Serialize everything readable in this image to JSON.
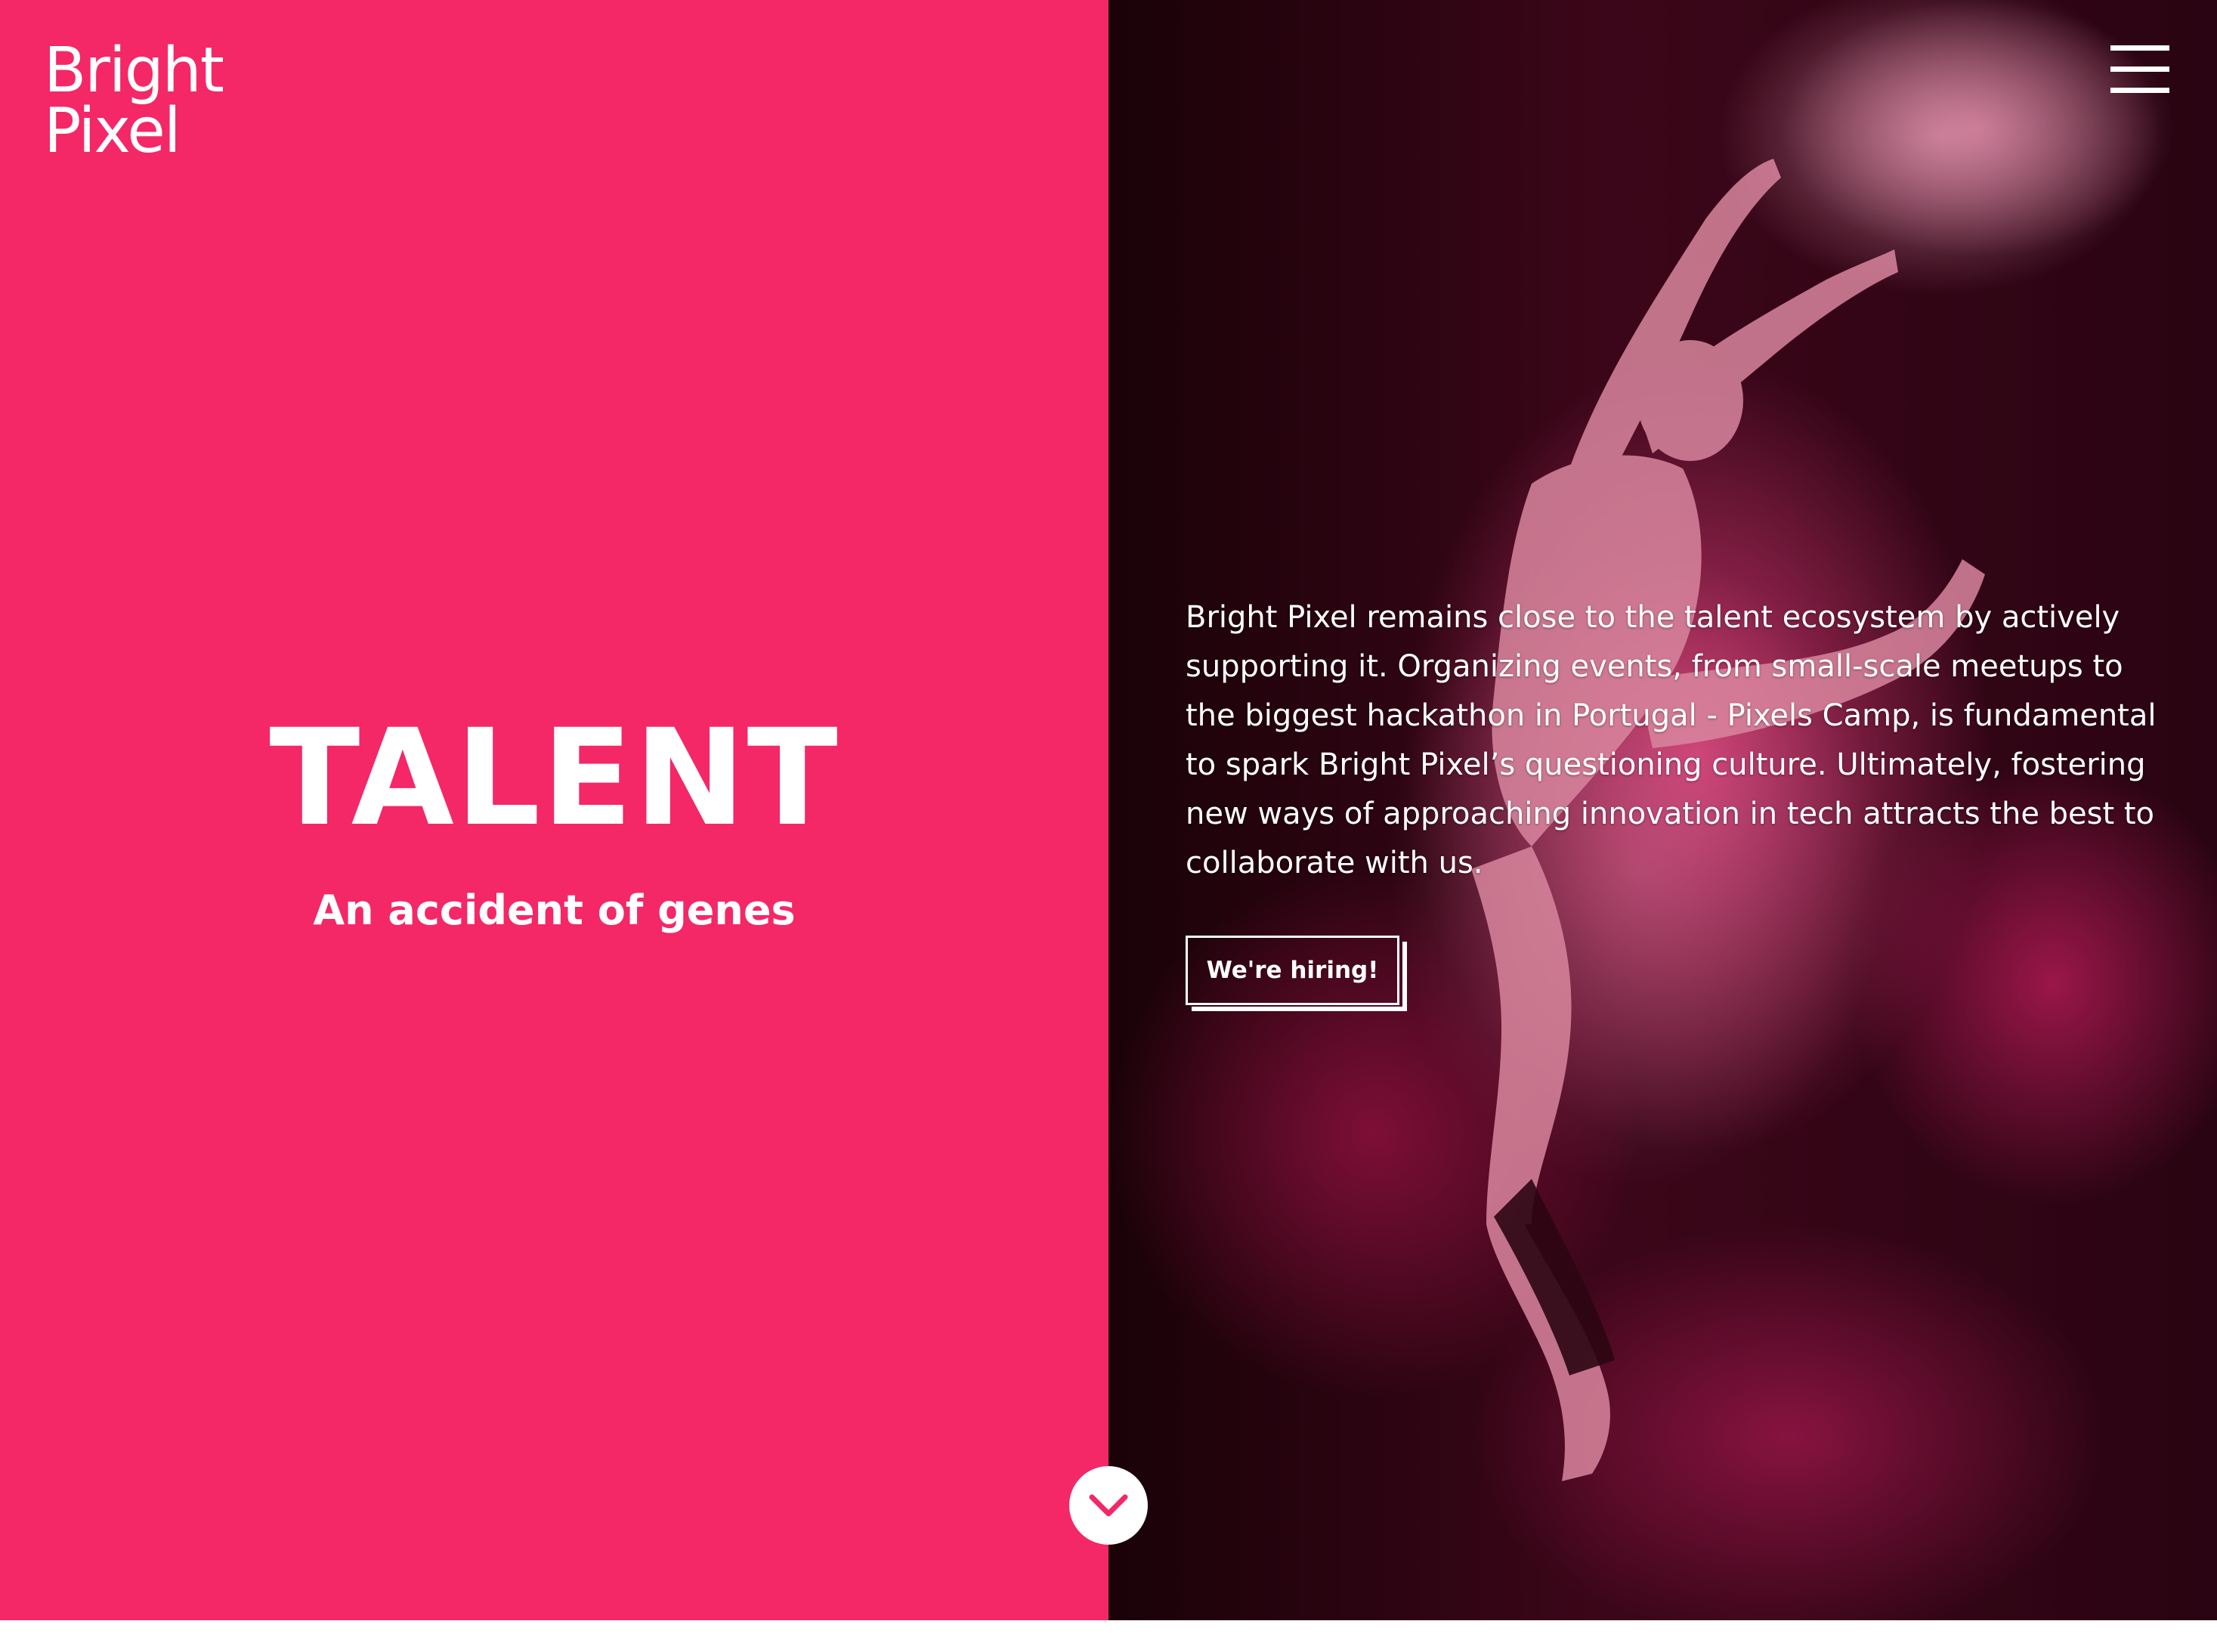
{
  "brand": {
    "logo_line1": "Bright",
    "logo_line2": "Pixel"
  },
  "hero": {
    "title": "TALENT",
    "subtitle": "An accident of genes"
  },
  "content": {
    "paragraph": "Bright Pixel remains close to the talent ecosystem by actively supporting it. Organizing events, from small-scale meetups to the biggest hackathon in Portugal - Pixels Camp, is fundamental to spark Bright Pixel’s questioning culture. Ultimately, fostering new ways of approaching innovation in tech attracts the best to collaborate with us.",
    "cta_label": "We're hiring!"
  },
  "icons": {
    "menu": "hamburger-menu-icon",
    "scroll": "chevron-down-icon"
  },
  "colors": {
    "brand_pink": "#f42767",
    "photo_dark": "#2a0412",
    "text": "#ffffff"
  }
}
